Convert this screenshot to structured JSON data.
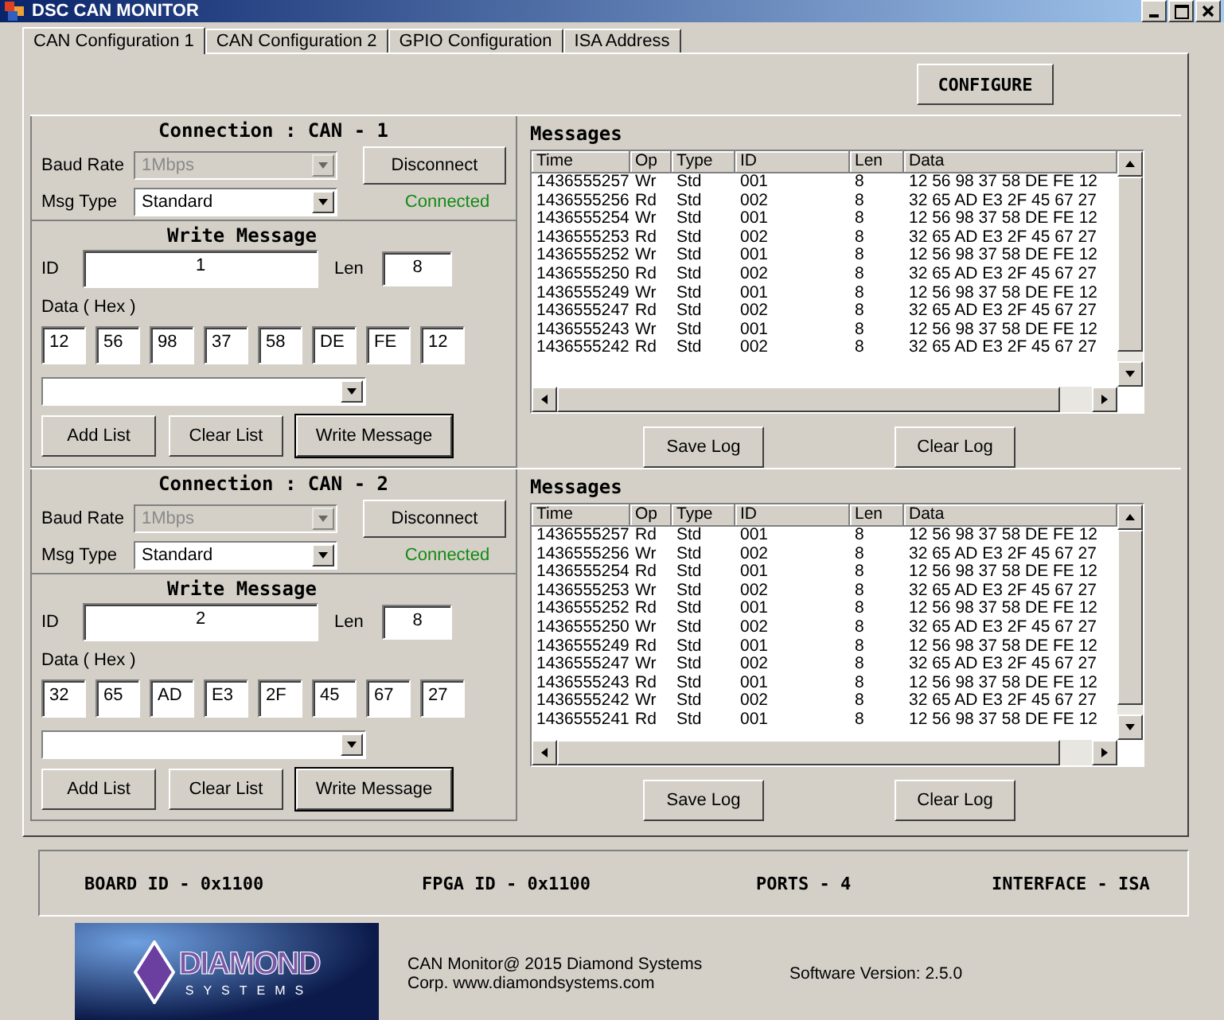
{
  "window": {
    "title": "DSC CAN MONITOR"
  },
  "tabs": [
    {
      "label": "CAN Configuration 1",
      "selected": true
    },
    {
      "label": "CAN Configuration 2",
      "selected": false
    },
    {
      "label": "GPIO Configuration",
      "selected": false
    },
    {
      "label": "ISA Address",
      "selected": false
    }
  ],
  "configure_button": "CONFIGURE",
  "can_panels": [
    {
      "connection_title": "Connection : CAN - 1",
      "baud_rate_label": "Baud Rate",
      "baud_rate": {
        "value": "1Mbps",
        "disabled": true
      },
      "msg_type_label": "Msg Type",
      "msg_type": {
        "value": "Standard",
        "disabled": false
      },
      "disconnect_button": "Disconnect",
      "status": "Connected",
      "write_title": "Write Message",
      "id_label": "ID",
      "id_value": "1",
      "len_label": "Len",
      "len_value": "8",
      "data_label": "Data ( Hex )",
      "data_bytes": [
        "12",
        "56",
        "98",
        "37",
        "58",
        "DE",
        "FE",
        "12"
      ],
      "add_list_button": "Add List",
      "clear_list_button": "Clear List",
      "write_message_button": "Write Message",
      "messages": {
        "title": "Messages",
        "columns": [
          "Time",
          "Op",
          "Type",
          "ID",
          "Len",
          "Data"
        ],
        "rows": [
          [
            "1436555257",
            "Wr",
            "Std",
            "001",
            "8",
            "12 56 98 37 58 DE FE 12"
          ],
          [
            "1436555256",
            "Rd",
            "Std",
            "002",
            "8",
            "32 65 AD E3 2F 45 67 27"
          ],
          [
            "1436555254",
            "Wr",
            "Std",
            "001",
            "8",
            "12 56 98 37 58 DE FE 12"
          ],
          [
            "1436555253",
            "Rd",
            "Std",
            "002",
            "8",
            "32 65 AD E3 2F 45 67 27"
          ],
          [
            "1436555252",
            "Wr",
            "Std",
            "001",
            "8",
            "12 56 98 37 58 DE FE 12"
          ],
          [
            "1436555250",
            "Rd",
            "Std",
            "002",
            "8",
            "32 65 AD E3 2F 45 67 27"
          ],
          [
            "1436555249",
            "Wr",
            "Std",
            "001",
            "8",
            "12 56 98 37 58 DE FE 12"
          ],
          [
            "1436555247",
            "Rd",
            "Std",
            "002",
            "8",
            "32 65 AD E3 2F 45 67 27"
          ],
          [
            "1436555243",
            "Wr",
            "Std",
            "001",
            "8",
            "12 56 98 37 58 DE FE 12"
          ],
          [
            "1436555242",
            "Rd",
            "Std",
            "002",
            "8",
            "32 65 AD E3 2F 45 67 27"
          ]
        ]
      },
      "save_log_button": "Save Log",
      "clear_log_button": "Clear Log"
    },
    {
      "connection_title": "Connection : CAN - 2",
      "baud_rate_label": "Baud Rate",
      "baud_rate": {
        "value": "1Mbps",
        "disabled": true
      },
      "msg_type_label": "Msg Type",
      "msg_type": {
        "value": "Standard",
        "disabled": false
      },
      "disconnect_button": "Disconnect",
      "status": "Connected",
      "write_title": "Write Message",
      "id_label": "ID",
      "id_value": "2",
      "len_label": "Len",
      "len_value": "8",
      "data_label": "Data ( Hex )",
      "data_bytes": [
        "32",
        "65",
        "AD",
        "E3",
        "2F",
        "45",
        "67",
        "27"
      ],
      "add_list_button": "Add List",
      "clear_list_button": "Clear List",
      "write_message_button": "Write Message",
      "messages": {
        "title": "Messages",
        "columns": [
          "Time",
          "Op",
          "Type",
          "ID",
          "Len",
          "Data"
        ],
        "rows": [
          [
            "1436555257",
            "Rd",
            "Std",
            "001",
            "8",
            "12 56 98 37 58 DE FE 12"
          ],
          [
            "1436555256",
            "Wr",
            "Std",
            "002",
            "8",
            "32 65 AD E3 2F 45 67 27"
          ],
          [
            "1436555254",
            "Rd",
            "Std",
            "001",
            "8",
            "12 56 98 37 58 DE FE 12"
          ],
          [
            "1436555253",
            "Wr",
            "Std",
            "002",
            "8",
            "32 65 AD E3 2F 45 67 27"
          ],
          [
            "1436555252",
            "Rd",
            "Std",
            "001",
            "8",
            "12 56 98 37 58 DE FE 12"
          ],
          [
            "1436555250",
            "Wr",
            "Std",
            "002",
            "8",
            "32 65 AD E3 2F 45 67 27"
          ],
          [
            "1436555249",
            "Rd",
            "Std",
            "001",
            "8",
            "12 56 98 37 58 DE FE 12"
          ],
          [
            "1436555247",
            "Wr",
            "Std",
            "002",
            "8",
            "32 65 AD E3 2F 45 67 27"
          ],
          [
            "1436555243",
            "Rd",
            "Std",
            "001",
            "8",
            "12 56 98 37 58 DE FE 12"
          ],
          [
            "1436555242",
            "Wr",
            "Std",
            "002",
            "8",
            "32 65 AD E3 2F 45 67 27"
          ],
          [
            "1436555241",
            "Rd",
            "Std",
            "001",
            "8",
            "12 56 98 37 58 DE FE 12"
          ]
        ]
      },
      "save_log_button": "Save Log",
      "clear_log_button": "Clear Log"
    }
  ],
  "status_bar": [
    "BOARD ID - 0x1100",
    "FPGA ID - 0x1100",
    "PORTS - 4",
    "INTERFACE - ISA"
  ],
  "footer": {
    "logo_name": "DIAMOND",
    "logo_subtitle": "SYSTEMS",
    "copyright": [
      "CAN Monitor@ 2015  Diamond Systems",
      "Corp. www.diamondsystems.com"
    ],
    "version": "Software Version: 2.5.0"
  }
}
